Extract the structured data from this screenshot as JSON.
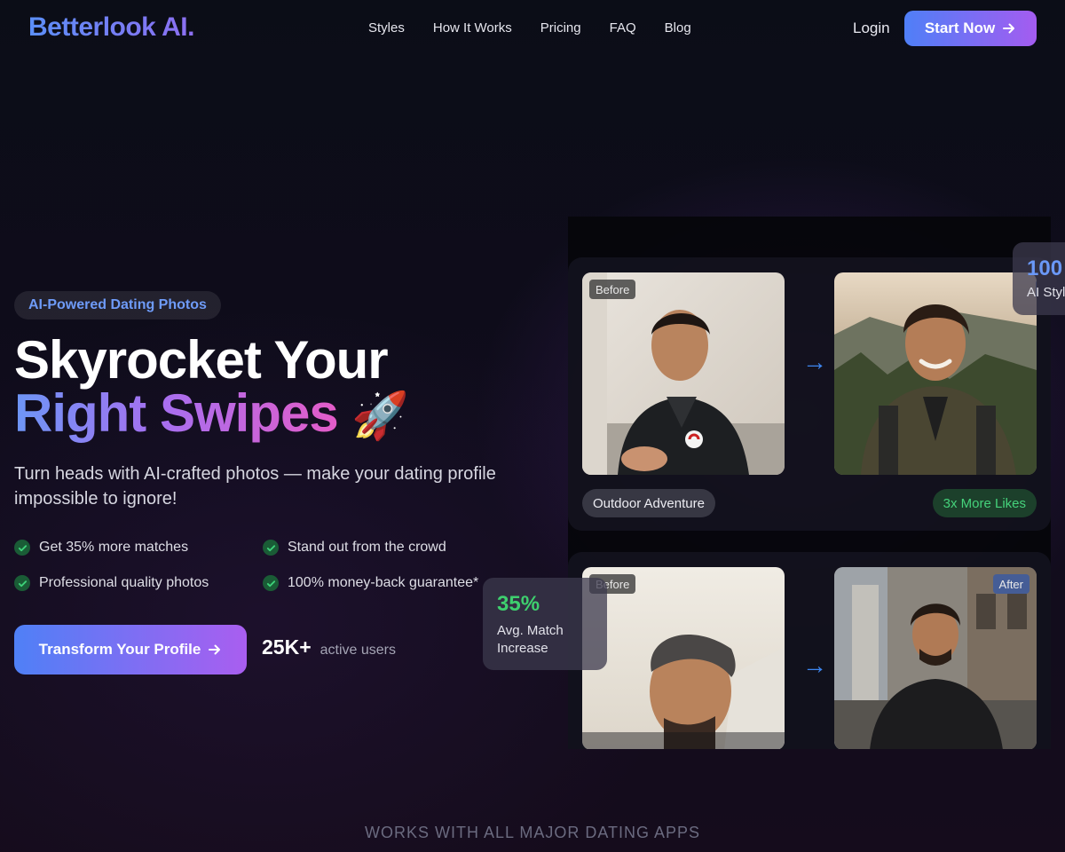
{
  "nav": {
    "logo": "Betterlook AI.",
    "links": [
      "Styles",
      "How It Works",
      "Pricing",
      "FAQ",
      "Blog"
    ],
    "login": "Login",
    "start": "Start Now"
  },
  "hero": {
    "badge": "AI-Powered Dating Photos",
    "title_line1": "Skyrocket Your",
    "title_line2_a": "Right Swipes",
    "title_emoji": "🚀",
    "subtitle": "Turn heads with AI-crafted photos — make your dating profile impossible to ignore!",
    "features": [
      "Get 35% more matches",
      "Stand out from the crowd",
      "Professional quality photos",
      "100% money-back guarantee*"
    ],
    "cta": "Transform Your Profile",
    "users_count": "25K+",
    "users_label": "active users"
  },
  "showcase": {
    "before_label": "Before",
    "after_label": "After",
    "card1_style": "Outdoor Adventure",
    "card1_result": "3x More Likes"
  },
  "stats": {
    "match_pct": "35%",
    "match_label_1": "Avg. Match",
    "match_label_2": "Increase",
    "styles_num": "100",
    "styles_label": "AI Styl"
  },
  "footer": {
    "works_with": "WORKS WITH ALL MAJOR DATING APPS"
  },
  "colors": {
    "accent_blue": "#4f7ff7",
    "accent_purple": "#a45cf0",
    "success_green": "#3ecf6e"
  }
}
